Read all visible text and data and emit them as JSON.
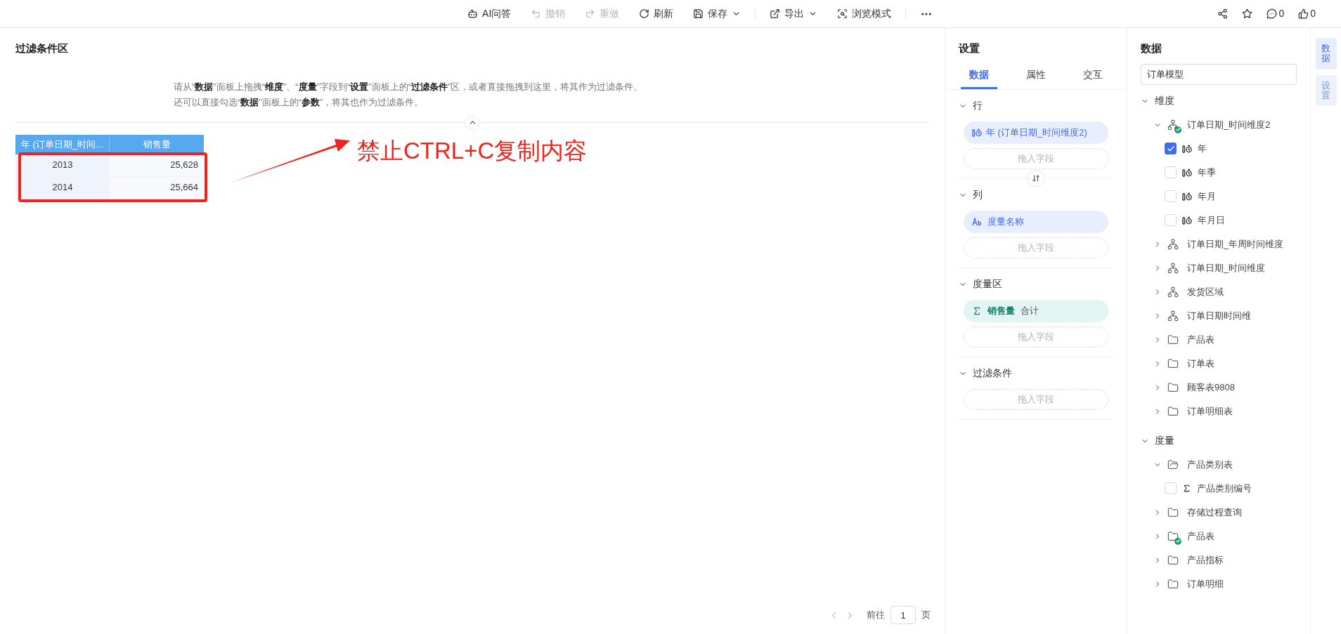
{
  "toolbar": {
    "items": [
      {
        "label": "AI问答",
        "disabled": false,
        "dropdown": false
      },
      {
        "label": "撤销",
        "disabled": true,
        "dropdown": false
      },
      {
        "label": "重做",
        "disabled": true,
        "dropdown": false
      },
      {
        "label": "刷新",
        "disabled": false,
        "dropdown": false
      },
      {
        "label": "保存",
        "disabled": false,
        "dropdown": true
      },
      {
        "label": "导出",
        "disabled": false,
        "dropdown": true
      },
      {
        "label": "浏览模式",
        "disabled": false,
        "dropdown": false
      }
    ],
    "comment_count": "0",
    "like_count": "0"
  },
  "canvas": {
    "title": "过滤条件区",
    "hint_lines": [
      "请从“**数据**”面板上拖拽“**维度**”、“**度量**”字段到“**设置**”面板上的“**过滤条件**”区，或者直接拖拽到这里，将其作为过滤条件。",
      "还可以直接勾选“**数据**”面板上的“**参数**”，将其也作为过滤条件。"
    ],
    "table": {
      "columns": [
        "年 (订单日期_时间...",
        "销售量"
      ],
      "rows": [
        [
          "2013",
          "25,628"
        ],
        [
          "2014",
          "25,664"
        ]
      ]
    },
    "annotation": "禁止CTRL+C复制内容",
    "pagination": {
      "prefix": "前往",
      "page": "1",
      "suffix": "页"
    }
  },
  "settings": {
    "title": "设置",
    "tabs": [
      {
        "label": "数据",
        "selected": true
      },
      {
        "label": "属性",
        "selected": false
      },
      {
        "label": "交互",
        "selected": false
      }
    ],
    "sections": [
      {
        "title": "行",
        "expanded": true,
        "fields": [
          {
            "kind": "date",
            "label": "年 (订单日期_时间维度2)"
          }
        ],
        "drop": "拖入字段"
      },
      {
        "title": "列",
        "expanded": true,
        "fields": [
          {
            "kind": "text",
            "label": "度量名称"
          }
        ],
        "drop": "拖入字段"
      },
      {
        "title": "度量区",
        "expanded": true,
        "fields": [
          {
            "kind": "measure",
            "label": "销售量",
            "agg": "合计"
          }
        ],
        "drop": "拖入字段"
      },
      {
        "title": "过滤条件",
        "expanded": true,
        "drop": "拖入字段"
      }
    ]
  },
  "data": {
    "title": "数据",
    "model": "订单模型",
    "groups": [
      {
        "label": "维度",
        "expanded": true,
        "children": [
          {
            "kind": "hierarchy",
            "label": "订单日期_时间维度2",
            "expanded": true,
            "used": true,
            "children": [
              {
                "kind": "date",
                "label": "年",
                "checked": true
              },
              {
                "kind": "date",
                "label": "年季",
                "checked": false
              },
              {
                "kind": "date",
                "label": "年月",
                "checked": false
              },
              {
                "kind": "date",
                "label": "年月日",
                "checked": false
              }
            ]
          },
          {
            "kind": "hierarchy",
            "label": "订单日期_年周时间维度",
            "expanded": false,
            "used": false
          },
          {
            "kind": "hierarchy",
            "label": "订单日期_时间维度",
            "expanded": false,
            "used": false
          },
          {
            "kind": "hierarchy",
            "label": "发货区域",
            "expanded": false,
            "used": false
          },
          {
            "kind": "hierarchy",
            "label": "订单日期时间维",
            "expanded": false,
            "used": false
          },
          {
            "kind": "folder",
            "label": "产品表",
            "expanded": false,
            "used": false
          },
          {
            "kind": "folder",
            "label": "订单表",
            "expanded": false,
            "used": false
          },
          {
            "kind": "folder",
            "label": "顾客表9808",
            "expanded": false,
            "used": false
          },
          {
            "kind": "folder",
            "label": "订单明细表",
            "expanded": false,
            "used": false
          }
        ]
      },
      {
        "label": "度量",
        "expanded": true,
        "children": [
          {
            "kind": "folder",
            "label": "产品类别表",
            "expanded": true,
            "used": false,
            "children": [
              {
                "kind": "measure",
                "label": "产品类别编号",
                "checked": false
              }
            ]
          },
          {
            "kind": "folder",
            "label": "存储过程查询",
            "expanded": false,
            "used": false
          },
          {
            "kind": "folder",
            "label": "产品表",
            "expanded": false,
            "used": true
          },
          {
            "kind": "folder",
            "label": "产品指标",
            "expanded": false,
            "used": false
          },
          {
            "kind": "folder",
            "label": "订单明细",
            "expanded": false,
            "used": false
          }
        ]
      }
    ]
  },
  "rail": [
    {
      "label": "数据",
      "selected": true
    },
    {
      "label": "设置",
      "selected": false
    }
  ]
}
